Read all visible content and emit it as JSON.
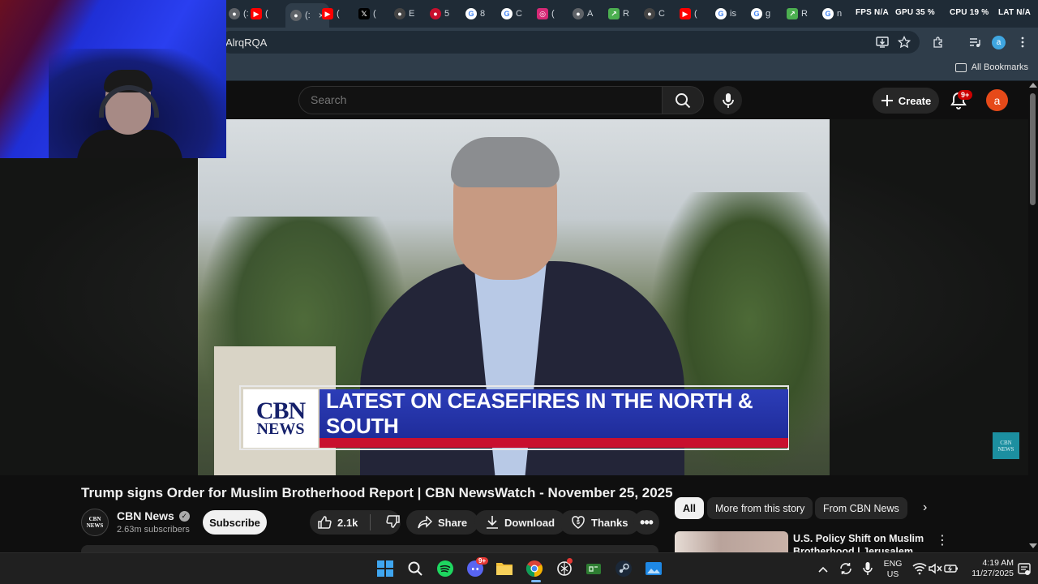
{
  "browser": {
    "tabs": [
      {
        "label": "(:",
        "favicon": "page-icon",
        "color": "#5f6368"
      },
      {
        "label": "(",
        "favicon": "youtube-icon",
        "color": "#ff0000"
      },
      {
        "label": "(:",
        "favicon": "page-icon",
        "color": "#5f6368",
        "active": true
      },
      {
        "label": "(",
        "favicon": "youtube-icon",
        "color": "#ff0000"
      },
      {
        "label": "(",
        "favicon": "x-icon",
        "color": "#000000"
      },
      {
        "label": "E",
        "favicon": "page-icon",
        "color": "#444444"
      },
      {
        "label": "5",
        "favicon": "page-icon",
        "color": "#c8102e"
      },
      {
        "label": "8",
        "favicon": "google-icon",
        "color": "#4285f4"
      },
      {
        "label": "C",
        "favicon": "google-icon",
        "color": "#4285f4"
      },
      {
        "label": "(",
        "favicon": "instagram-icon",
        "color": "#d62976"
      },
      {
        "label": "A",
        "favicon": "page-icon",
        "color": "#5f6368"
      },
      {
        "label": "R",
        "favicon": "chart-icon",
        "color": "#4caf50"
      },
      {
        "label": "C",
        "favicon": "page-icon",
        "color": "#444444"
      },
      {
        "label": "(",
        "favicon": "youtube-icon",
        "color": "#ff0000"
      },
      {
        "label": "is",
        "favicon": "google-icon",
        "color": "#4285f4"
      },
      {
        "label": "g",
        "favicon": "google-icon",
        "color": "#4285f4"
      },
      {
        "label": "R",
        "favicon": "chart-icon",
        "color": "#4caf50"
      },
      {
        "label": "n",
        "favicon": "google-icon",
        "color": "#4285f4"
      }
    ],
    "active_tab_close": "×",
    "url": "AlrqRQA",
    "all_bookmarks": "All Bookmarks",
    "profile_initial": "a"
  },
  "hud": {
    "fps_label": "FPS",
    "fps_value": "N/A",
    "gpu_label": "GPU",
    "gpu_value": "35 %",
    "cpu_label": "CPU",
    "cpu_value": "19 %",
    "lat_label": "LAT",
    "lat_value": "N/A"
  },
  "youtube": {
    "search_placeholder": "Search",
    "create_label": "Create",
    "notification_count": "9+",
    "avatar_initial": "a"
  },
  "video": {
    "lower_third_logo_line1": "CBN",
    "lower_third_logo_line2": "NEWS",
    "headline": "LATEST ON CEASEFIRES IN THE NORTH & SOUTH",
    "watermark_line1": "CBN",
    "watermark_line2": "NEWS"
  },
  "details": {
    "title": "Trump signs Order for Muslim Brotherhood Report | CBN NewsWatch - November 25, 2025",
    "channel_name": "CBN News",
    "channel_avatar_line1": "CBN",
    "channel_avatar_line2": "NEWS",
    "subscribers": "2.63m subscribers",
    "subscribe_label": "Subscribe",
    "likes": "2.1k",
    "share_label": "Share",
    "download_label": "Download",
    "thanks_label": "Thanks",
    "more_label": "•••"
  },
  "sidebar": {
    "chips": [
      "All",
      "More from this story",
      "From CBN News"
    ],
    "next_chip": "›",
    "recommended_title": "U.S. Policy Shift on Muslim Brotherhood | Jerusalem",
    "recommended_menu": "⋮"
  },
  "taskbar": {
    "apps": [
      "windows-start-icon",
      "search-icon",
      "spotify-icon",
      "discord-icon",
      "file-explorer-icon",
      "chrome-icon",
      "chatgpt-icon",
      "xbox-icon",
      "steam-icon",
      "photos-icon"
    ],
    "discord_badge": "9+",
    "language_line1": "ENG",
    "language_line2": "US",
    "time": "4:19 AM",
    "date": "11/27/2025"
  }
}
